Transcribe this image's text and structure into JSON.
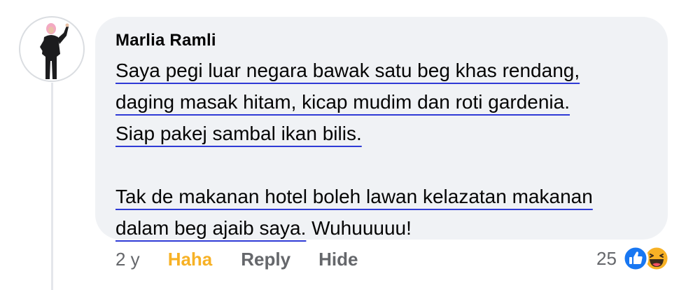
{
  "comment": {
    "author": "Marlia Ramli",
    "paragraphs": [
      [
        {
          "text": "Saya pegi luar negara bawak satu beg khas rendang,",
          "underline": true
        },
        {
          "text": "daging masak hitam, kicap mudim dan roti gardenia. ",
          "underline": true
        },
        {
          "text": "Siap pakej sambal ikan bilis.",
          "underline": true
        }
      ],
      [
        {
          "text": "Tak de makanan hotel boleh lawan kelazatan makanan",
          "underline": true
        },
        {
          "text": "dalam beg ajaib saya.",
          "underline": true,
          "suffix": " Wuhuuuuu!"
        }
      ]
    ]
  },
  "actions": {
    "timestamp": "2 y",
    "haha_label": "Haha",
    "reply_label": "Reply",
    "hide_label": "Hide"
  },
  "reactions": {
    "count": "25",
    "icons": [
      "like-icon",
      "haha-icon"
    ]
  },
  "colors": {
    "bubble": "#f0f2f5",
    "haha": "#f7b125",
    "like": "#1877f2",
    "secondary_text": "#65676b",
    "underline": "#2f3bd6"
  }
}
